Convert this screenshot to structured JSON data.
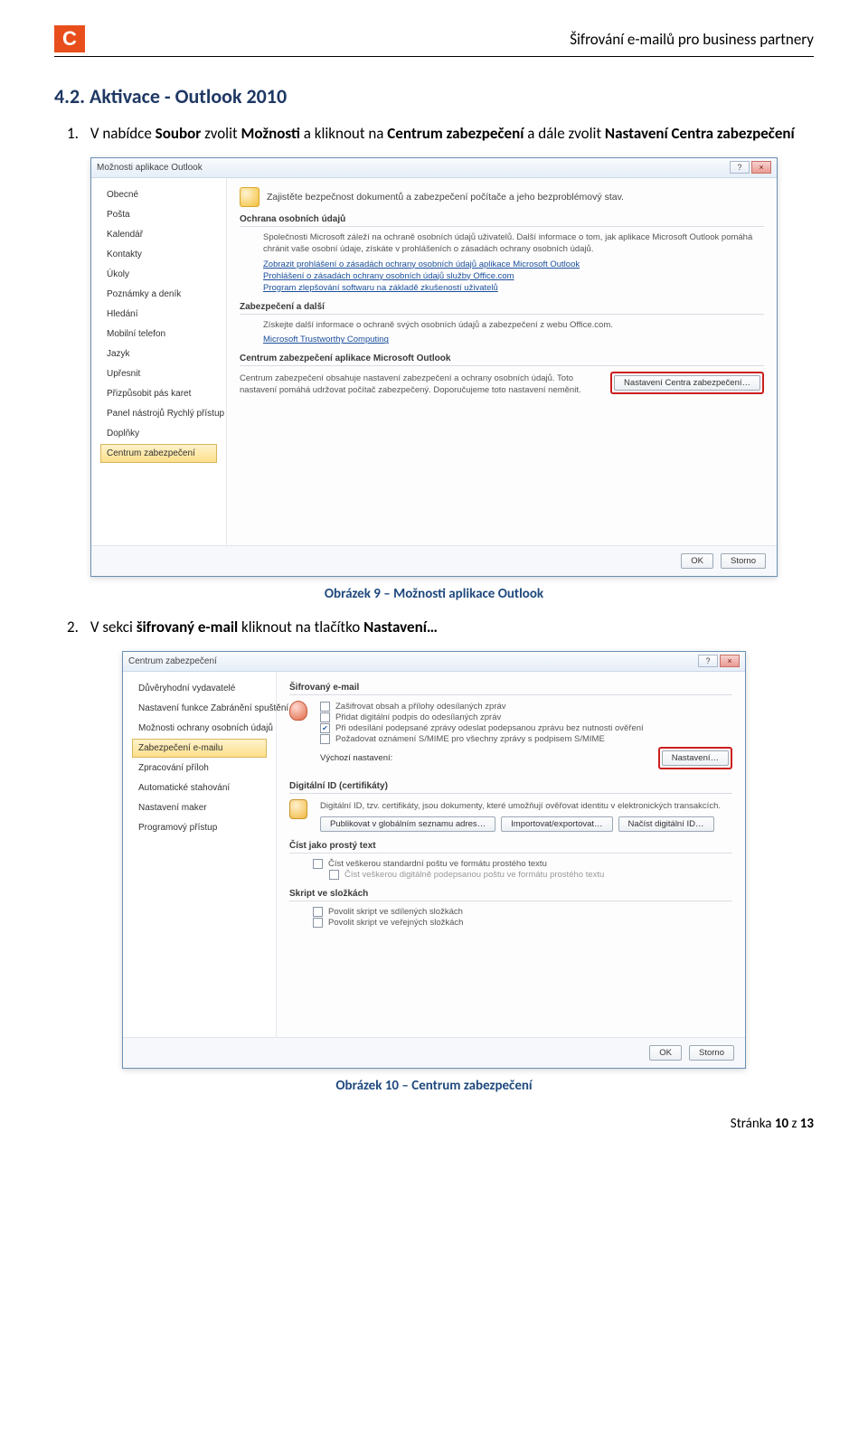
{
  "doc": {
    "header_title": "Šifrování e-mailů pro business partnery",
    "logo_letter": "C",
    "heading": "4.2. Aktivace - Outlook 2010",
    "step1_num": "1.",
    "step1_a": "V nabídce ",
    "step1_b": "Soubor",
    "step1_c": " zvolit ",
    "step1_d": "Možnosti",
    "step1_e": " a kliknout na ",
    "step1_f": "Centrum zabezpečení",
    "step1_g": " a dále zvolit ",
    "step1_h": "Nastavení Centra zabezpečení",
    "caption1": "Obrázek 9 – Možnosti aplikace Outlook",
    "step2_num": "2.",
    "step2_a": "V sekci ",
    "step2_b": "šifrovaný e-mail",
    "step2_c": " kliknout na tlačítko ",
    "step2_d": "Nastavení…",
    "caption2": "Obrázek 10 – Centrum zabezpečení",
    "footer_a": "Stránka ",
    "footer_b": "10",
    "footer_c": " z ",
    "footer_d": "13"
  },
  "win1": {
    "title": "Možnosti aplikace Outlook",
    "nav": [
      "Obecné",
      "Pošta",
      "Kalendář",
      "Kontakty",
      "Úkoly",
      "Poznámky a deník",
      "Hledání",
      "Mobilní telefon",
      "Jazyk",
      "Upřesnit",
      "Přizpůsobit pás karet",
      "Panel nástrojů Rychlý přístup",
      "Doplňky",
      "Centrum zabezpečení"
    ],
    "nav_selected": 13,
    "lead": "Zajistěte bezpečnost dokumentů a zabezpečení počítače a jeho bezproblémový stav.",
    "g1": "Ochrana osobních údajů",
    "g1_desc": "Společnosti Microsoft záleží na ochraně osobních údajů uživatelů. Další informace o tom, jak aplikace Microsoft Outlook pomáhá chránit vaše osobní údaje, získáte v prohlášeních o zásadách ochrany osobních údajů.",
    "g1_links": [
      "Zobrazit prohlášení o zásadách ochrany osobních údajů aplikace Microsoft Outlook",
      "Prohlášení o zásadách ochrany osobních údajů služby Office.com",
      "Program zlepšování softwaru na základě zkušeností uživatelů"
    ],
    "g2": "Zabezpečení a další",
    "g2_desc": "Získejte další informace o ochraně svých osobních údajů a zabezpečení z webu Office.com.",
    "g2_link": "Microsoft Trustworthy Computing",
    "g3": "Centrum zabezpečení aplikace Microsoft Outlook",
    "g3_desc": "Centrum zabezpečení obsahuje nastavení zabezpečení a ochrany osobních údajů. Toto nastavení pomáhá udržovat počítač zabezpečený. Doporučujeme toto nastavení neměnit.",
    "g3_btn": "Nastavení Centra zabezpečení…",
    "ok": "OK",
    "cancel": "Storno"
  },
  "win2": {
    "title": "Centrum zabezpečení",
    "nav": [
      "Důvěryhodní vydavatelé",
      "Nastavení funkce Zabránění spuštění dat",
      "Možnosti ochrany osobních údajů",
      "Zabezpečení e-mailu",
      "Zpracování příloh",
      "Automatické stahování",
      "Nastavení maker",
      "Programový přístup"
    ],
    "nav_selected": 3,
    "g1": "Šifrovaný e-mail",
    "g1_chk1": "Zašifrovat obsah a přílohy odesílaných zpráv",
    "g1_chk2": "Přidat digitální podpis do odesílaných zpráv",
    "g1_chk3": "Při odesílání podepsané zprávy odeslat podepsanou zprávu bez nutnosti ověření",
    "g1_chk4": "Požadovat oznámení S/MIME pro všechny zprávy s podpisem S/MIME",
    "g1_kv_label": "Výchozí nastavení:",
    "g1_btn": "Nastavení…",
    "g2": "Digitální ID (certifikáty)",
    "g2_desc": "Digitální ID, tzv. certifikáty, jsou dokumenty, které umožňují ověřovat identitu v elektronických transakcích.",
    "g2_b1": "Publikovat v globálním seznamu adres…",
    "g2_b2": "Importovat/exportovat…",
    "g2_b3": "Načíst digitální ID…",
    "g3": "Číst jako prostý text",
    "g3_chk1": "Číst veškerou standardní poštu ve formátu prostého textu",
    "g3_chk2": "Číst veškerou digitálně podepsanou poštu ve formátu prostého textu",
    "g4": "Skript ve složkách",
    "g4_chk1": "Povolit skript ve sdílených složkách",
    "g4_chk2": "Povolit skript ve veřejných složkách",
    "ok": "OK",
    "cancel": "Storno"
  }
}
